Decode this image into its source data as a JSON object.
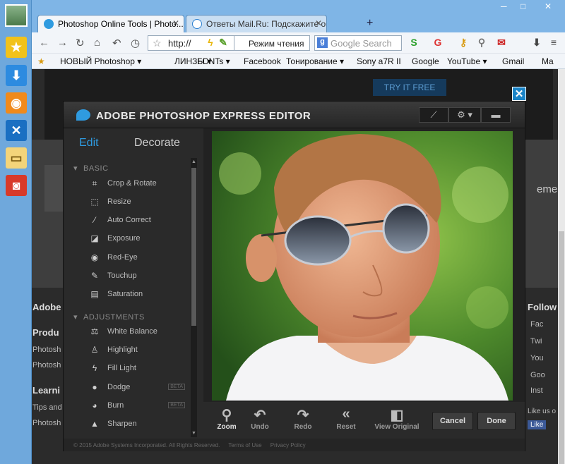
{
  "browser": {
    "tabs": [
      {
        "title": "Photoshop Online Tools | Photo...",
        "active": true
      },
      {
        "title": "Ответы Mail.Ru: Подскажите он...",
        "active": false
      }
    ],
    "new_tab": "+",
    "window_controls": [
      "─",
      "□",
      "✕"
    ],
    "url": "http://",
    "read_mode": "Режим чтения",
    "search_placeholder": "Google Search",
    "bookmarks": [
      "НОВЫЙ Photoshop ▾",
      "ЛИНЗЫ ▾",
      "FONTs ▾",
      "Facebook",
      "Тонирование ▾",
      "Sony a7R II",
      "Google",
      "YouTube ▾",
      "Gmail",
      "Ma"
    ]
  },
  "sidebar_icons": [
    "star-icon",
    "download-icon",
    "rss-icon",
    "tools-icon",
    "window-icon",
    "gamepad-icon"
  ],
  "page": {
    "try_button": "TRY IT FREE",
    "right_partial": "ement",
    "footer_left": [
      "Adobe",
      "Produ",
      "Photosh",
      "Photosh",
      "Learni",
      "Tips and",
      "Photosh"
    ],
    "footer_right": [
      "Follow",
      "Fac",
      "Twi",
      "You",
      "Goo",
      "Inst",
      "Like us o",
      "Like"
    ]
  },
  "editor": {
    "title": "ADOBE PHOTOSHOP EXPRESS EDITOR",
    "modes": {
      "edit": "Edit",
      "decorate": "Decorate"
    },
    "sections": [
      {
        "heading": "BASIC",
        "items": [
          {
            "label": "Crop & Rotate",
            "icon": "⌗"
          },
          {
            "label": "Resize",
            "icon": "⬚"
          },
          {
            "label": "Auto Correct",
            "icon": "⁄"
          },
          {
            "label": "Exposure",
            "icon": "◪"
          },
          {
            "label": "Red-Eye",
            "icon": "◉"
          },
          {
            "label": "Touchup",
            "icon": "✎"
          },
          {
            "label": "Saturation",
            "icon": "▤"
          }
        ]
      },
      {
        "heading": "ADJUSTMENTS",
        "items": [
          {
            "label": "White Balance",
            "icon": "⚖"
          },
          {
            "label": "Highlight",
            "icon": "♙"
          },
          {
            "label": "Fill Light",
            "icon": "ϟ"
          },
          {
            "label": "Dodge",
            "icon": "●",
            "badge": "BETA"
          },
          {
            "label": "Burn",
            "icon": "◕",
            "badge": "BETA"
          },
          {
            "label": "Sharpen",
            "icon": "▲"
          }
        ]
      }
    ],
    "bottom_tools": [
      {
        "label": "Zoom",
        "icon": "⚲"
      },
      {
        "label": "Undo",
        "icon": "↶"
      },
      {
        "label": "Redo",
        "icon": "↷"
      },
      {
        "label": "Reset",
        "icon": "«"
      },
      {
        "label": "View Original",
        "icon": "◧"
      }
    ],
    "cancel": "Cancel",
    "done": "Done",
    "footer": {
      "copyright": "© 2015 Adobe Systems Incorporated. All Rights Reserved.",
      "terms": "Terms of Use",
      "privacy": "Privacy Policy"
    }
  }
}
